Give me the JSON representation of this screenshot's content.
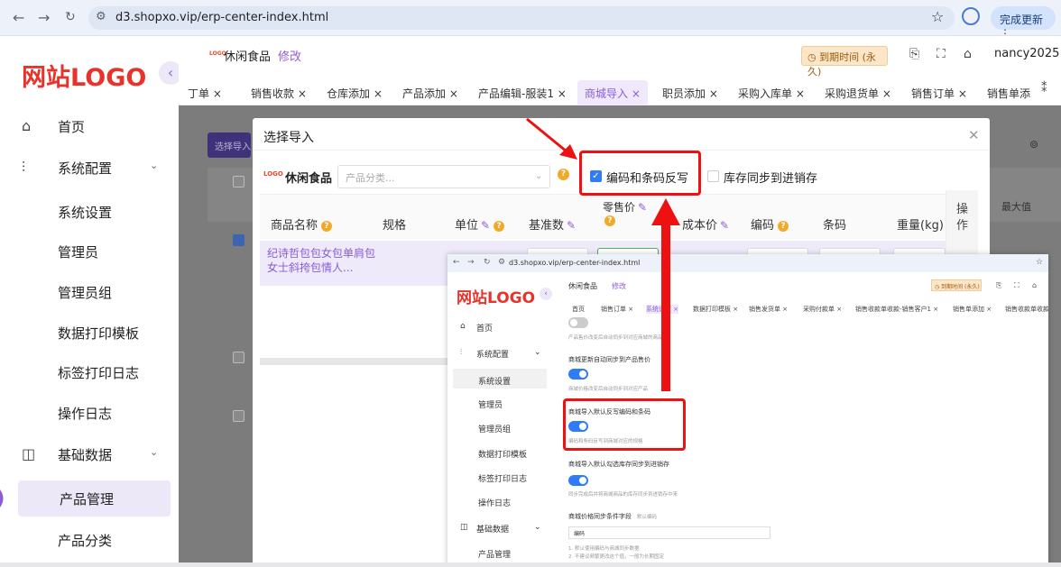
{
  "browser": {
    "url": "d3.shopxo.vip/erp-center-index.html",
    "update_label": "完成更新 ⋮"
  },
  "sidebar": {
    "logo": "网站LOGO",
    "items": [
      {
        "label": "首页",
        "icon": "home-icon"
      },
      {
        "label": "系统配置",
        "icon": "sliders-icon"
      },
      {
        "label": "系统设置"
      },
      {
        "label": "管理员"
      },
      {
        "label": "管理员组"
      },
      {
        "label": "数据打印模板"
      },
      {
        "label": "标签打印日志"
      },
      {
        "label": "操作日志"
      },
      {
        "label": "基础数据",
        "icon": "chart-icon"
      },
      {
        "label": "产品管理"
      },
      {
        "label": "产品分类"
      }
    ]
  },
  "header": {
    "shop_logo": "LOGO",
    "shop_name": "休闲食品",
    "edit_label": "修改",
    "expire_label": "◷ 到期时间 (永久)",
    "username": "nancy2025"
  },
  "tabs": [
    "丁单 ×",
    "销售收款 ×",
    "仓库添加 ×",
    "产品添加 ×",
    "产品编辑-服装1 ×",
    "商城导入 ×",
    "职员添加 ×",
    "采购入库单 ×",
    "采购退货单 ×",
    "销售订单 ×",
    "销售单添"
  ],
  "main": {
    "select_import_btn": "选择导入",
    "right_text": "最大值"
  },
  "modal": {
    "title": "选择导入",
    "shop_logo": "LOGO",
    "shop_name": "休闲食品",
    "category_placeholder": "产品分类...",
    "checkbox_code_label": "编码和条码反写",
    "checkbox_stock_label": "库存同步到进销存",
    "columns": {
      "name": "商品名称",
      "spec": "规格",
      "unit": "单位",
      "base_qty": "基准数",
      "retail_price": "零售价",
      "cost_price": "成本价",
      "code": "编码",
      "barcode": "条码",
      "weight": "重量(kg)",
      "op_1": "操",
      "op_2": "作"
    },
    "row": {
      "product_name": "纪诗哲包包女包单肩包女士斜挎包情人..."
    }
  },
  "inset": {
    "url": "d3.shopxo.vip/erp-center-index.html",
    "logo": "网站LOGO",
    "shop_name": "休闲食品",
    "edit_label": "修改",
    "expire_label": "◷ 到期时间 (永久)",
    "menu": [
      "首页",
      "系统配置",
      "系统设置",
      "管理员",
      "管理员组",
      "数据打印模板",
      "标签打印日志",
      "操作日志",
      "基础数据",
      "产品管理"
    ],
    "tabs": [
      "首页",
      "销售订单 ×",
      "系统设置 ×",
      "数据打印模板 ×",
      "销售发货单 ×",
      "采购付款单 ×",
      "销售收款单收款-销售客户1 ×",
      "销售单添加 ×",
      "销售收款单收款"
    ],
    "settings": {
      "s0_desc": "产品售价改变后自动同步到对应商城的商品",
      "s1_title": "商城更新自动同步到产品售价",
      "s1_desc": "商城价格改变后自动同步到对应产品",
      "s2_title": "商城导入默认反写编码和条码",
      "s2_desc": "编码和条码反写到商城对应的规格",
      "s3_title": "商城导入默认勾选库存同步到进销存",
      "s3_desc": "同步完成后并将商城商品的库存同步到进销存中来",
      "s4_title": "商城价格同步条件字段",
      "s4_hint": "默认编码",
      "s4_value": "编码",
      "note1": "1. 默认使用编码与商城同步数据",
      "note2": "2. 不建议频繁更改这个值，一般为长期固定"
    }
  }
}
